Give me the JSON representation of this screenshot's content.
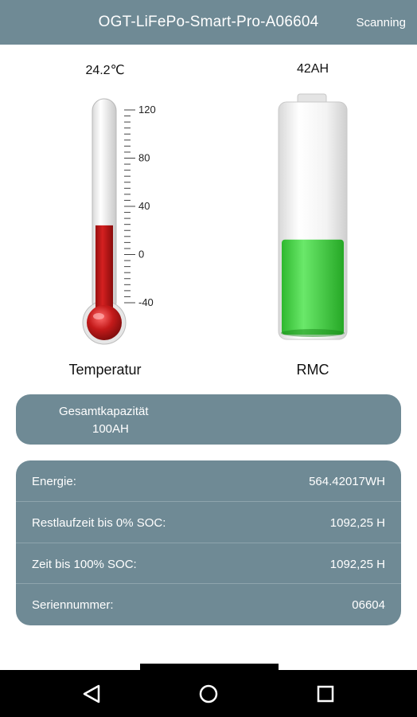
{
  "header": {
    "title": "OGT-LiFePo-Smart-Pro-A06604",
    "status": "Scanning"
  },
  "temperature": {
    "value": "24.2℃",
    "label": "Temperatur",
    "scale": [
      "120",
      "80",
      "40",
      "0",
      "-40"
    ],
    "reading_celsius": 24.2,
    "range": [
      -40,
      120
    ],
    "color": "#c41a1a"
  },
  "rmc": {
    "value": "42AH",
    "label": "RMC",
    "fill_fraction": 0.42,
    "color": "#3fcf3f"
  },
  "capacity": {
    "title": "Gesamtkapazität",
    "value": "100AH"
  },
  "details": [
    {
      "key": "Energie:",
      "value": "564.42017WH"
    },
    {
      "key": "Restlaufzeit bis 0% SOC:",
      "value": "1092,25 H"
    },
    {
      "key": "Zeit bis 100% SOC:",
      "value": "1092,25 H"
    },
    {
      "key": "Seriennummer:",
      "value": "06604"
    }
  ],
  "navbar": {
    "icons": [
      "back-icon",
      "home-icon",
      "recents-icon"
    ]
  },
  "colors": {
    "header_bg": "#6f8a95",
    "card_bg": "#6f8a95"
  }
}
